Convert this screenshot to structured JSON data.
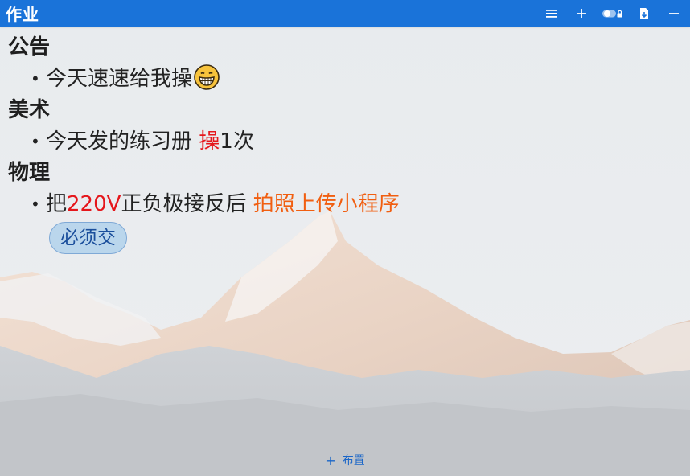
{
  "window": {
    "title": "作业",
    "accent_color": "#1a73d9"
  },
  "toolbar": {
    "icons": [
      "menu-icon",
      "plus-icon",
      "toggle-lock-icon",
      "export-file-icon",
      "minimize-icon"
    ]
  },
  "sections": [
    {
      "heading": "公告",
      "items": [
        {
          "parts": [
            {
              "text": "今天速速给我操",
              "style": "normal"
            }
          ],
          "emoji": "grinning-face-emoji"
        }
      ]
    },
    {
      "heading": "美术",
      "items": [
        {
          "parts": [
            {
              "text": "今天发的练习册 ",
              "style": "normal"
            },
            {
              "text": "操",
              "style": "red"
            },
            {
              "text": "1次",
              "style": "normal"
            }
          ]
        }
      ]
    },
    {
      "heading": "物理",
      "items": [
        {
          "parts": [
            {
              "text": "把",
              "style": "normal"
            },
            {
              "text": "220V",
              "style": "red"
            },
            {
              "text": "正负极接反后 ",
              "style": "normal"
            },
            {
              "text": "拍照上传小程序",
              "style": "orange"
            }
          ]
        }
      ],
      "tag": "必须交"
    }
  ],
  "footer": {
    "add_label": "布置"
  },
  "colors": {
    "red_text": "#e5161b",
    "orange_text": "#f15e10",
    "tag_text": "#1b4f9c"
  }
}
